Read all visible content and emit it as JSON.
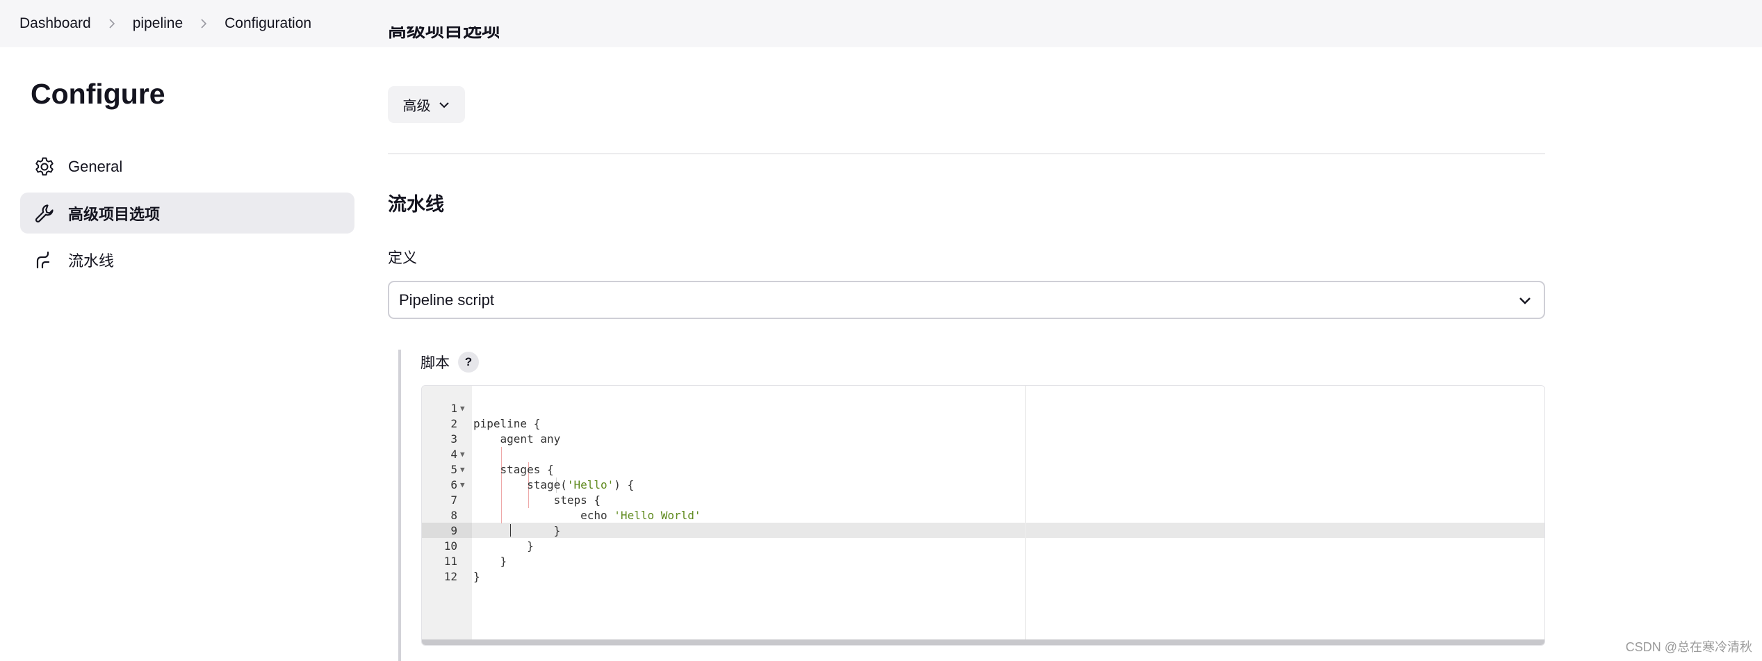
{
  "breadcrumb": {
    "items": [
      "Dashboard",
      "pipeline",
      "Configuration"
    ]
  },
  "sidebar": {
    "title": "Configure",
    "items": [
      {
        "label": "General",
        "icon": "gear-icon"
      },
      {
        "label": "高级项目选项",
        "icon": "wrench-icon",
        "active": true
      },
      {
        "label": "流水线",
        "icon": "pipeline-icon"
      }
    ]
  },
  "main": {
    "cut_heading": "高级项目选项",
    "advanced_button": "高级",
    "pipeline_section_title": "流水线",
    "definition_label": "定义",
    "definition_value": "Pipeline script",
    "script_label": "脚本",
    "help_label": "?"
  },
  "editor": {
    "active_line": 10,
    "lines": [
      {
        "n": "1",
        "text": "pipeline {"
      },
      {
        "n": "2",
        "text": "    agent any"
      },
      {
        "n": "3",
        "text": ""
      },
      {
        "n": "4",
        "text": "    stages {"
      },
      {
        "n": "5",
        "pre": "        stage(",
        "str": "'Hello'",
        "post": ") {"
      },
      {
        "n": "6",
        "text": "            steps {"
      },
      {
        "n": "7",
        "pre": "                echo ",
        "str": "'Hello World'",
        "post": ""
      },
      {
        "n": "8",
        "text": "            }"
      },
      {
        "n": "9",
        "text": "        }"
      },
      {
        "n": "10",
        "text": "    }"
      },
      {
        "n": "11",
        "text": "}"
      },
      {
        "n": "12",
        "text": ""
      }
    ]
  },
  "watermark": "CSDN @总在寒冷清秋",
  "colors": {
    "topbar_bg": "#f6f6f8",
    "active_item_bg": "#ebebef",
    "string_color": "#5f8a1e",
    "text": "#14141f"
  }
}
